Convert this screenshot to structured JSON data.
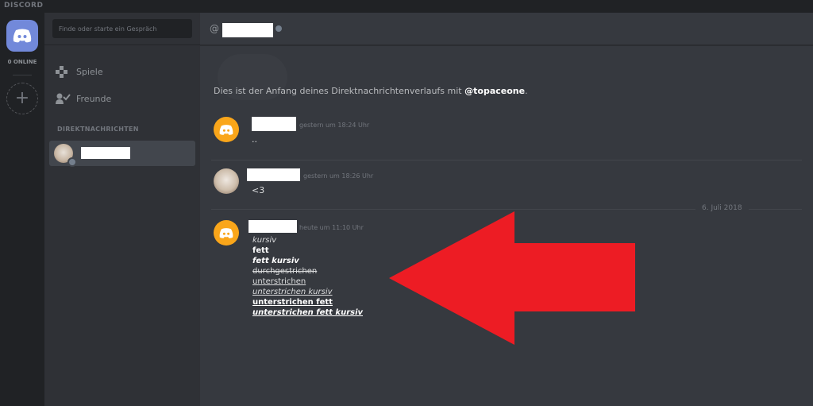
{
  "app": {
    "brand": "DISCORD"
  },
  "guilds": {
    "online_count": "0 ONLINE",
    "add_symbol": "+"
  },
  "sidebar": {
    "search_placeholder": "Finde oder starte ein Gespräch",
    "nav": [
      {
        "label": "Spiele",
        "icon": "gamepad-icon"
      },
      {
        "label": "Freunde",
        "icon": "friends-icon"
      }
    ],
    "section_title": "DIREKTNACHRICHTEN"
  },
  "header": {
    "at_symbol": "@"
  },
  "conversation": {
    "intro_prefix": "Dies ist der Anfang deines Direktnachrichtenverlaufs mit ",
    "intro_user": "@topaceone",
    "intro_suffix": ".",
    "messages": [
      {
        "timestamp": "gestern um 18:24 Uhr",
        "text": "..",
        "avatar": "discord-logo-icon"
      },
      {
        "timestamp": "gestern um 18:26 Uhr",
        "text": "<3",
        "avatar": "user-photo"
      },
      {
        "timestamp": "heute um 11:10 Uhr",
        "avatar": "discord-logo-icon",
        "lines": [
          "kursiv",
          "fett",
          "fett kursiv",
          "durchgestrichen",
          "unterstrichen",
          "unterstrichen kursiv",
          "unterstrichen fett",
          "unterstrichen fett kursiv"
        ]
      }
    ],
    "date_divider": "6. Juli 2018"
  },
  "colors": {
    "accent": "#7289da",
    "avatar_orange": "#faa61a",
    "annotation_arrow": "#ed1c24",
    "background": "#36393f",
    "sidebar": "#2f3136"
  }
}
